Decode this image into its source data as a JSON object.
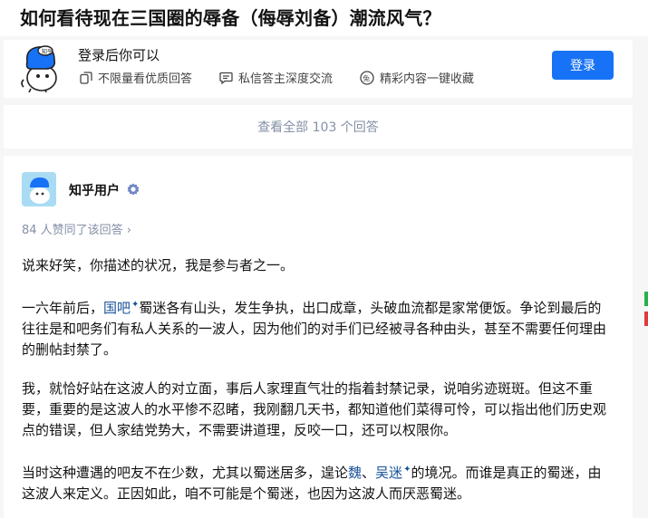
{
  "question": {
    "title": "如何看待现在三国圈的辱备（侮辱刘备）潮流风气？"
  },
  "login_prompt": {
    "heading": "登录后你可以",
    "benefits": [
      {
        "icon": "copy-icon",
        "label": "不限量看优质回答"
      },
      {
        "icon": "chat-icon",
        "label": "私信答主深度交流"
      },
      {
        "icon": "collect-icon",
        "label": "精彩内容一键收藏"
      }
    ],
    "login_label": "登录"
  },
  "view_all": {
    "label": "查看全部 103 个回答"
  },
  "answer": {
    "author": "知乎用户",
    "votes_text": "84 人赞同了该回答 ›",
    "paragraphs": {
      "p1": "说来好笑，你描述的状况，我是参与者之一。",
      "p2_a": "一六年前后，",
      "p2_link": "国吧",
      "p2_b": "蜀迷各有山头，发生争执，出口成章，头破血流都是家常便饭。争论到最后的往往是和吧务们有私人关系的一波人，因为他们的对手们已经被寻各种由头，甚至不需要任何理由的删帖封禁了。",
      "p3": "我，就恰好站在这波人的对立面，事后人家理直气壮的指着封禁记录，说咱劣迹斑斑。但这不重要，重要的是这波人的水平惨不忍睹，我刚翻几天书，都知道他们菜得可怜，可以指出他们历史观点的错误，但人家结党势大，不需要讲道理，反咬一口，还可以权限你。",
      "p4_a": "当时这种遭遇的吧友不在少数，尤其以蜀迷居多，遑论",
      "p4_link1": "魏",
      "p4_sep": "、",
      "p4_link2": "吴迷",
      "p4_b": "的境况。而谁是真正的蜀迷，由这波人来定义。正因如此，咱不可能是个蜀迷，也因为这波人而厌恶蜀迷。"
    },
    "spark_glyph": "✦"
  },
  "colors": {
    "brand_blue": "#1772f6",
    "link_blue": "#175199",
    "meta_gray": "#8590a6"
  }
}
